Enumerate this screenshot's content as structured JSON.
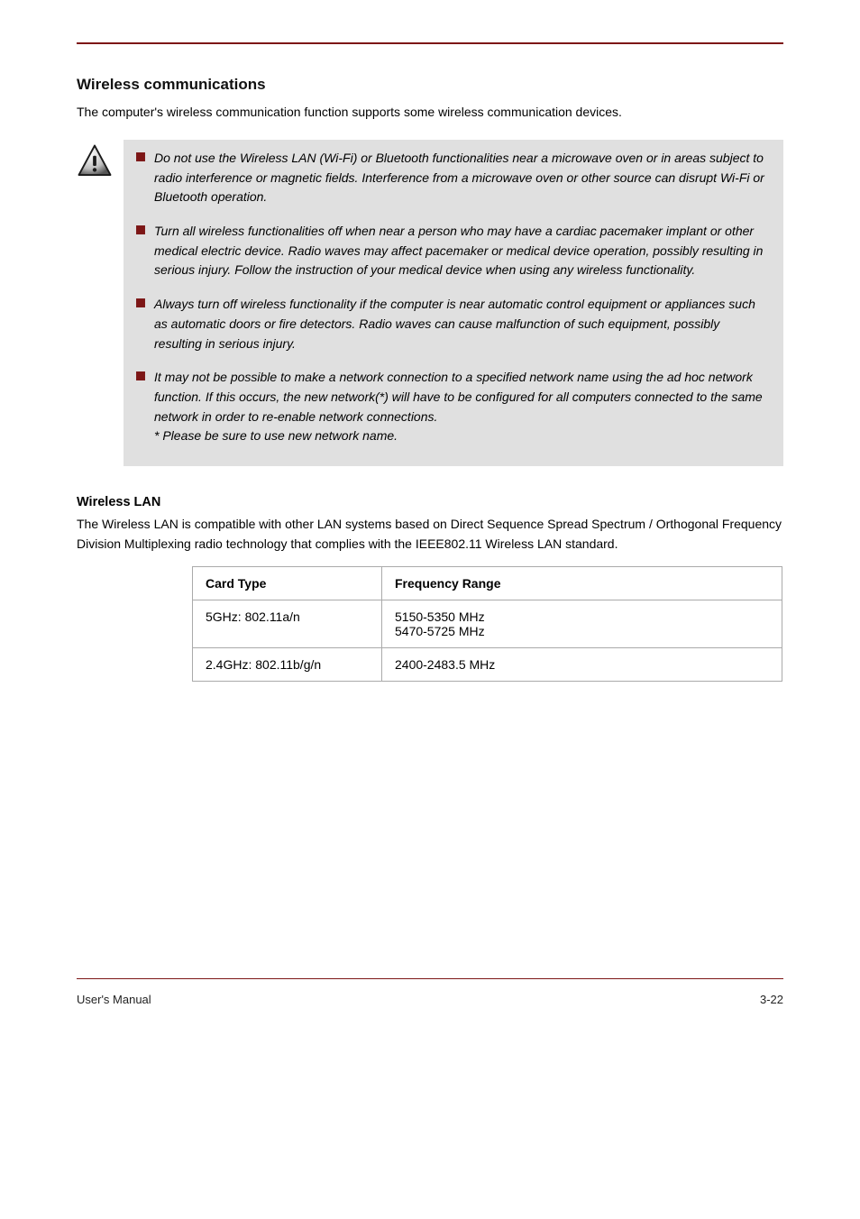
{
  "section": {
    "heading": "Wireless communications",
    "intro": "The computer's wireless communication function supports some wireless communication devices."
  },
  "cautions": [
    "Do not use the Wireless LAN (Wi-Fi) or Bluetooth functionalities near a microwave oven or in areas subject to radio interference or magnetic fields. Interference from a microwave oven or other source can disrupt Wi-Fi or Bluetooth operation.",
    "Turn all wireless functionalities off when near a person who may have a cardiac pacemaker implant or other medical electric device. Radio waves may affect pacemaker or medical device operation, possibly resulting in serious injury. Follow the instruction of your medical device when using any wireless functionality.",
    "Always turn off wireless functionality if the computer is near automatic control equipment or appliances such as automatic doors or fire detectors. Radio waves can cause malfunction of such equipment, possibly resulting in serious injury.",
    "It may not be possible to make a network connection to a specified network name using the ad hoc network function. If this occurs, the new network(*) will have to be configured for all computers connected to the same network in order to re-enable network connections.\n* Please be sure to use new network name."
  ],
  "wifi": {
    "heading": "Wireless LAN",
    "para": "The Wireless LAN is compatible with other LAN systems based on Direct Sequence Spread Spectrum / Orthogonal Frequency Division Multiplexing radio technology that complies with the IEEE802.11 Wireless LAN standard."
  },
  "table": {
    "header": {
      "a": "Card Type",
      "b": "Frequency Range"
    },
    "row1": {
      "a": "5GHz: 802.11a/n",
      "b": "5150-5350 MHz\n5470-5725 MHz"
    },
    "row2": {
      "a": "2.4GHz: 802.11b/g/n",
      "b": "2400-2483.5 MHz"
    }
  },
  "footer": {
    "left": "User's Manual",
    "right": "3-22"
  }
}
